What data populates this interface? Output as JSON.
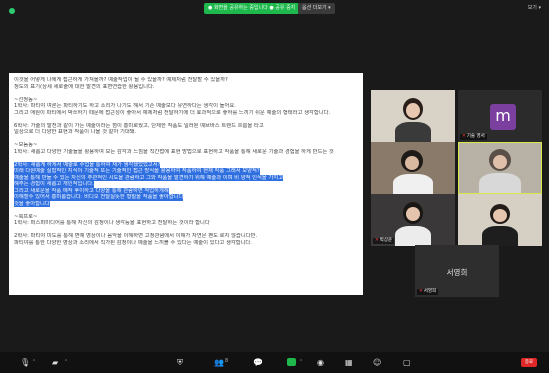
{
  "top_bar": {
    "share_banner": "● 화면을 공유하는 중입니다 ● 공유 중지",
    "options_label": "옵션 더보기 ▾",
    "view_label": "보기 ▾"
  },
  "document": {
    "lines": [
      {
        "text": "이것을 어떻게 나에게 접근하게 가져올까? 예술작업이 될 수 있을까? 예제처럼 전달할 수 있을까?",
        "hl": false
      },
      {
        "text": "정도의 표기(상세 세로줄에 대한 발견의 표면연습한 활용입니다.",
        "hl": false
      },
      {
        "text": "",
        "hl": false
      },
      {
        "text": "~선정동~",
        "hl": false
      },
      {
        "text": "1학사: 파티야 여론는 파티하기도 하고 소리가 나기도 해서 기존 예술보다 유연하다는 생각이 들어요.",
        "hl": false
      },
      {
        "text": "그리고 애원이 파티에서 박쓰하기 때문에 접근성이 좋아서 예제처럼 전달하기에 더 효과적으로 좋하를 느끼기 쉬운 예술의 형태라고 생각합니다.",
        "hl": false
      },
      {
        "text": "",
        "hl": false
      },
      {
        "text": "6학사: 가술의 발전과 같이 가는 예술이라는 점이 흥미로웠고, 단체한 작품도 일러된 예브바스 트렌드 흐름을 타고",
        "hl": false
      },
      {
        "text": "일상으로 더 다양한 표현과 작품이 나올 것 같아 기대돼.",
        "hl": false
      },
      {
        "text": "",
        "hl": false
      },
      {
        "text": "~모둠동~",
        "hl": false
      },
      {
        "text": "1학사: 새롭고 다양한 기술들을 활용하여 모든 감각과 느낌을 직간접에 표현 방법으로 표현하고 작품을 통해 새로운 기술과 경험을 하게 만드는 것",
        "hl": false
      },
      {
        "text": "",
        "hl": false
      },
      {
        "text": "2학사: 새롭게 하게서 예술로 수업을 통하여 재가 생각했었었고서?",
        "hl": true
      },
      {
        "text": "미래 다원예술 실험적인 지식이 기술적 또는 기술적인 접근 방식을 활용하여 작품하여 현재 작품 그래서 모양적?",
        "hl": true
      },
      {
        "text": "예술을 통해 만들 수 있는 자신의 주관적인 시도을 관람하고 그와 작품을 발견하기 위해 예술과 이며 비 양적 인식을 가지고",
        "hl": true
      },
      {
        "text": "해주는 경험이 새롭고 개인적입니다.",
        "hl": true
      },
      {
        "text": "그리고 새로운을 작품 예작 후이하고 다양을 통해 관람하면 작업하게해",
        "hl": true
      },
      {
        "text": "이해할수 있어서 흥미롭습니다. 비디오 전달실뜻한 형질을 작품을 좋아합니다",
        "hl": true
      },
      {
        "text": "것을 좋아합니다",
        "hl": true
      },
      {
        "text": "",
        "hl": false
      },
      {
        "text": "~북프로~",
        "hl": false
      },
      {
        "text": "1학사: 퍼스퍼미디어를 통해 자신의 감정이나 생각등을 표현하고 전달하는 것이라 합니다",
        "hl": false
      },
      {
        "text": "",
        "hl": false
      },
      {
        "text": "2학사: 파티야 미도를 통해 면예 영상이나 음악을 이해하면 고정관념에서 이해가 자연은 펜도 로지 않습니다만.",
        "hl": false
      },
      {
        "text": "파티야를 통한 다양한 영상과 소리에서 직가된 감정이나 예술을 느끼볼 수 있다는 예술이 있다고 생각합니다.",
        "hl": false
      }
    ]
  },
  "participants": [
    {
      "name": "",
      "kind": "video"
    },
    {
      "name": "기술 영서",
      "kind": "avatar",
      "letter": "m"
    },
    {
      "name": "",
      "kind": "video"
    },
    {
      "name": "",
      "kind": "video"
    },
    {
      "name": "박상윤",
      "kind": "video"
    },
    {
      "name": "",
      "kind": "video"
    },
    {
      "name": "서영희",
      "kind": "name-only",
      "tag": "서영희"
    }
  ],
  "toolbar": {
    "icons": [
      "microphone-icon",
      "video-camera-icon",
      "security-icon",
      "participants-icon",
      "chat-icon",
      "share-screen-icon",
      "record-icon",
      "breakout-icon",
      "reactions-icon",
      "apps-icon"
    ],
    "participants_count": "8",
    "end_label": "종료"
  },
  "colors": {
    "highlight": "#2f6fe0",
    "share_green": "#1fb84c",
    "end_red": "#e02828",
    "avatar_purple": "#7b3fa0"
  }
}
